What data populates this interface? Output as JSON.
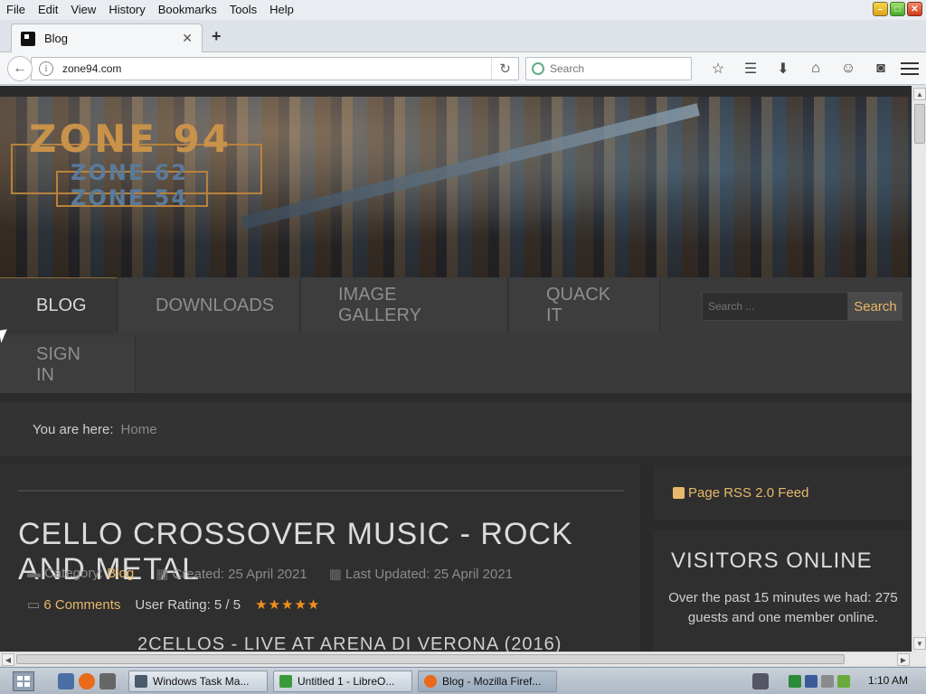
{
  "window": {
    "menu": [
      "File",
      "Edit",
      "View",
      "History",
      "Bookmarks",
      "Tools",
      "Help"
    ]
  },
  "tab": {
    "title": "Blog"
  },
  "navbar": {
    "url": "zone94.com",
    "search_placeholder": "Search"
  },
  "site": {
    "logo_main": "ZONE 94",
    "logo_sub1": "ZONE 62",
    "logo_sub2": "ZONE 54",
    "nav": [
      "BLOG",
      "DOWNLOADS",
      "IMAGE GALLERY",
      "QUACK IT",
      "SIGN IN"
    ],
    "search_placeholder": "Search ...",
    "search_button": "Search",
    "breadcrumb_label": "You are here:",
    "breadcrumb_home": "Home"
  },
  "article": {
    "title": "CELLO CROSSOVER MUSIC - ROCK AND METAL",
    "category_label": "Category:",
    "category": "Blog",
    "created": "Created: 25 April 2021",
    "updated": "Last Updated: 25 April 2021",
    "comments": "6 Comments",
    "rating_label": "User Rating: 5 / 5",
    "rating_value": 5,
    "video_title": "2CELLOS - LIVE AT ARENA DI VERONA (2016)"
  },
  "sidebar": {
    "rss": "Page RSS 2.0 Feed",
    "visitors_heading": "VISITORS ONLINE",
    "visitors_text": "Over the past 15 minutes we had: 275 guests and one member online."
  },
  "taskbar": {
    "buttons": [
      "Windows Task Ma...",
      "Untitled 1 - LibreO...",
      "Blog - Mozilla Firef..."
    ],
    "clock": "1:10 AM"
  },
  "colors": {
    "accent": "#e8b86a",
    "page_bg": "#2b2b2b",
    "star": "#f0901a"
  }
}
